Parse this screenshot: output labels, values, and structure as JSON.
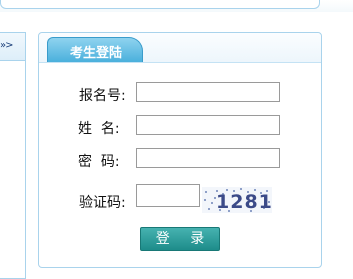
{
  "left_panel": {
    "more_link": "»>"
  },
  "login": {
    "title": "考生登陆",
    "fields": [
      {
        "label": "报名号:",
        "value": ""
      },
      {
        "label": "姓  名:",
        "value": ""
      },
      {
        "label": "密  码:",
        "value": ""
      },
      {
        "label": "验证码:",
        "value": ""
      }
    ],
    "captcha_code": "1281",
    "submit_label": "登 录"
  }
}
